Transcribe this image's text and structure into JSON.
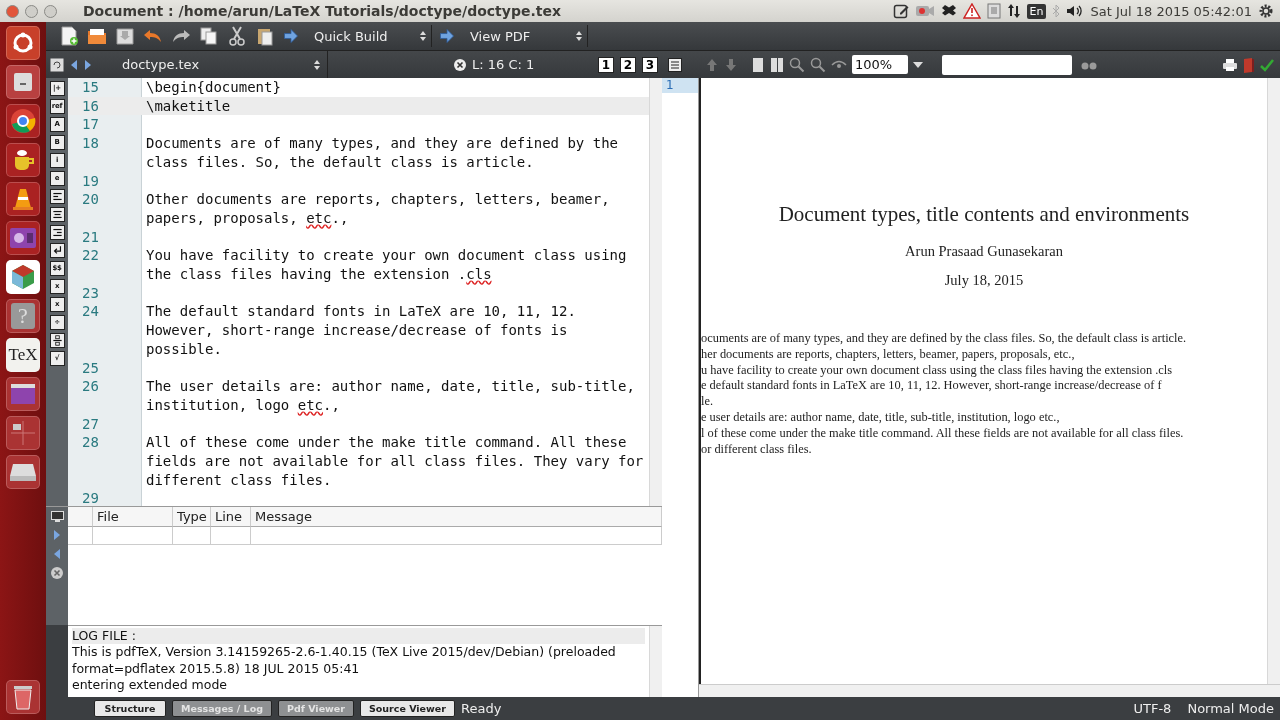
{
  "window": {
    "title": "Document : /home/arun/LaTeX Tutorials/doctype/doctype.tex"
  },
  "tray": {
    "keyboard_layout": "En",
    "datetime": "Sat Jul 18 2015 05:42:01"
  },
  "launcher": {
    "help_glyph": "?",
    "tex_label": "TeX"
  },
  "toolbar": {
    "build_select": "Quick Build",
    "view_select": "View PDF"
  },
  "editor_tabs": {
    "file_select": "doctype.tex",
    "position": "L: 16 C: 1",
    "view_buttons": [
      "1",
      "2",
      "3"
    ]
  },
  "format_buttons": [
    {
      "kind": "glyph",
      "label": "|+"
    },
    {
      "kind": "glyph",
      "label": "ref"
    },
    {
      "kind": "glyph",
      "label": "A"
    },
    {
      "kind": "glyph",
      "label": "B"
    },
    {
      "kind": "glyph",
      "label": "i"
    },
    {
      "kind": "glyph",
      "label": "e"
    },
    {
      "kind": "align-left"
    },
    {
      "kind": "align-center"
    },
    {
      "kind": "align-right"
    },
    {
      "kind": "return"
    },
    {
      "kind": "glyph",
      "label": "$$"
    },
    {
      "kind": "glyph",
      "label": "x"
    },
    {
      "kind": "glyph",
      "label": "x"
    },
    {
      "kind": "glyph",
      "label": "÷"
    },
    {
      "kind": "fraction"
    },
    {
      "kind": "glyph",
      "label": "√"
    }
  ],
  "editor": {
    "lines": [
      {
        "number": "15",
        "current": false,
        "rows": [
          [
            {
              "text": "\\begin{document}",
              "spell_error": false
            }
          ]
        ]
      },
      {
        "number": "16",
        "current": true,
        "rows": [
          [
            {
              "text": "\\maketitle",
              "spell_error": false
            }
          ]
        ]
      },
      {
        "number": "17",
        "current": false
      },
      {
        "number": "18",
        "current": false,
        "rows": [
          [
            {
              "text": "Documents are of many types, and they are defined by the",
              "spell_error": false
            }
          ],
          [
            {
              "text": "class files. So, the default class is article.",
              "spell_error": false
            }
          ]
        ]
      },
      {
        "number": "19",
        "current": false
      },
      {
        "number": "20",
        "current": false,
        "rows": [
          [
            {
              "text": "Other documents are reports, chapters, letters, beamer,",
              "spell_error": false
            }
          ],
          [
            {
              "text": "papers, proposals, ",
              "spell_error": false
            },
            {
              "text": "etc",
              "spell_error": true
            },
            {
              "text": ".,",
              "spell_error": false
            }
          ]
        ]
      },
      {
        "number": "21",
        "current": false
      },
      {
        "number": "22",
        "current": false,
        "rows": [
          [
            {
              "text": "You have facility to create your own document class using",
              "spell_error": false
            }
          ],
          [
            {
              "text": "the class files having the extension .",
              "spell_error": false
            },
            {
              "text": "cls",
              "spell_error": true
            }
          ]
        ]
      },
      {
        "number": "23",
        "current": false
      },
      {
        "number": "24",
        "current": false,
        "rows": [
          [
            {
              "text": "The default standard fonts in LaTeX are 10, 11, 12.",
              "spell_error": false
            }
          ],
          [
            {
              "text": "However, short-range increase/decrease of fonts is",
              "spell_error": false
            }
          ],
          [
            {
              "text": "possible.",
              "spell_error": false
            }
          ]
        ]
      },
      {
        "number": "25",
        "current": false
      },
      {
        "number": "26",
        "current": false,
        "rows": [
          [
            {
              "text": "The user details are: author name, date, title, sub-title,",
              "spell_error": false
            }
          ],
          [
            {
              "text": "institution, logo ",
              "spell_error": false
            },
            {
              "text": "etc",
              "spell_error": true
            },
            {
              "text": ".,",
              "spell_error": false
            }
          ]
        ]
      },
      {
        "number": "27",
        "current": false
      },
      {
        "number": "28",
        "current": false,
        "rows": [
          [
            {
              "text": "All of these come under the make title command. All these",
              "spell_error": false
            }
          ],
          [
            {
              "text": "fields are not available for all class files. They vary for",
              "spell_error": false
            }
          ],
          [
            {
              "text": "different class files.",
              "spell_error": false
            }
          ]
        ]
      },
      {
        "number": "29",
        "current": false
      }
    ]
  },
  "messages": {
    "columns": [
      "File",
      "Type",
      "Line",
      "Message"
    ]
  },
  "log": {
    "lines": [
      "LOG FILE :",
      "This is pdfTeX, Version 3.14159265-2.6-1.40.15 (TeX Live 2015/dev/Debian) (preloaded",
      "format=pdflatex 2015.5.8) 18 JUL 2015 05:41",
      "entering extended mode"
    ]
  },
  "pdf_toolbar": {
    "zoom": "100%"
  },
  "pdf": {
    "page_thumbnail": "1",
    "title": "Document types, title contents and environments",
    "author": "Arun Prasaad Gunasekaran",
    "date": "July 18, 2015",
    "body_lines": [
      "ocuments are of many types, and they are defined by the class files. So, the default class is article.",
      "her documents are reports, chapters, letters, beamer, papers, proposals, etc.,",
      "u have facility to create your own document class using the class files having the extension .cls",
      "e default standard fonts in LaTeX are 10, 11, 12.  However, short-range increase/decrease of f",
      "le.",
      "e user details are: author name, date, title, sub-title, institution, logo etc.,",
      "l of these come under the make title command.  All these fields are not available for all class files.",
      "or different class files."
    ]
  },
  "status_bar": {
    "tabs": [
      {
        "label": "Structure",
        "selected": false
      },
      {
        "label": "Messages / Log",
        "selected": true
      },
      {
        "label": "Pdf Viewer",
        "selected": true
      },
      {
        "label": "Source Viewer",
        "selected": false
      }
    ],
    "state": "Ready",
    "encoding": "UTF-8",
    "mode": "Normal Mode"
  }
}
